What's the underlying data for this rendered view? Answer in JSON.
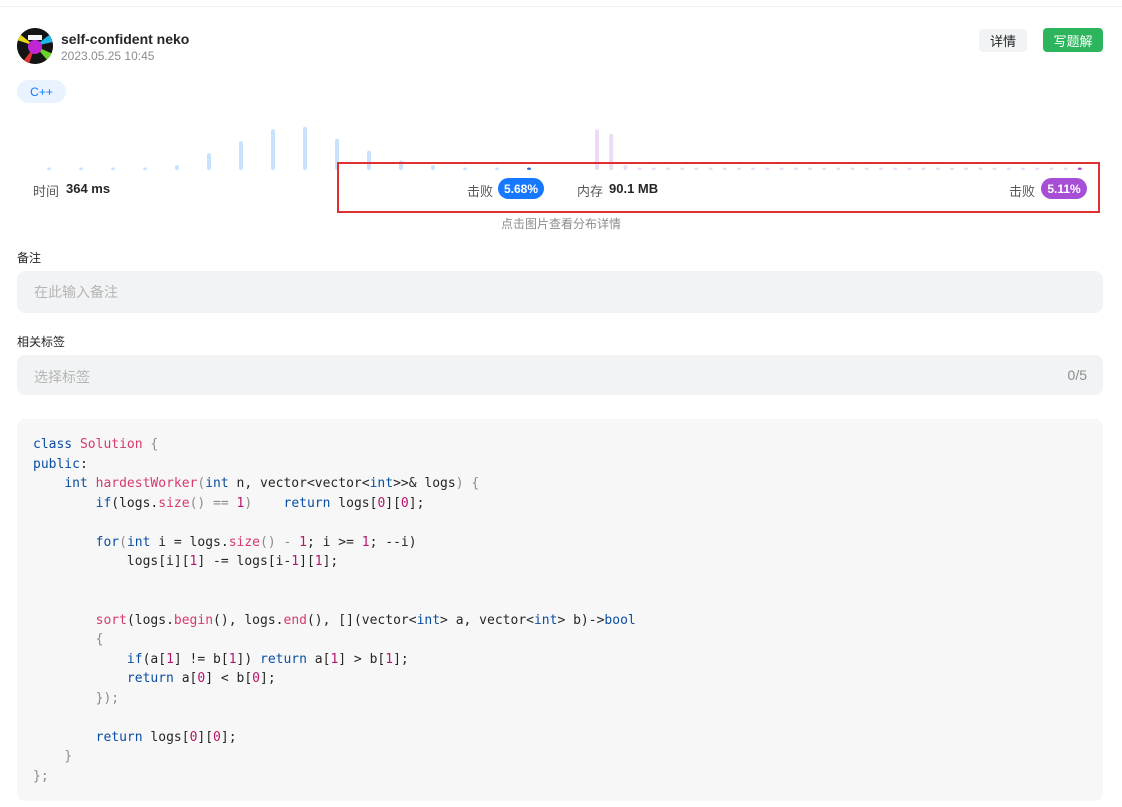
{
  "header": {
    "username": "self-confident neko",
    "timestamp": "2023.05.25 10:45",
    "detail_button": "详情",
    "write_solution_button": "写题解",
    "language_tag": "C++"
  },
  "stats": {
    "time_label": "时间",
    "time_value": "364 ms",
    "time_beat_label": "击败",
    "time_beat_value": "5.68%",
    "memory_label": "内存",
    "memory_value": "90.1 MB",
    "memory_beat_label": "击败",
    "memory_beat_value": "5.11%",
    "hint": "点击图片查看分布详情"
  },
  "chart_data": {
    "type": "bar",
    "series": [
      {
        "name": "",
        "color": "#c9e2fb",
        "highlight_color": "#2f6fcf",
        "values": [
          1,
          1,
          1,
          1,
          2,
          7,
          12,
          17,
          18,
          13,
          8,
          4,
          2,
          1,
          1,
          1
        ],
        "highlight_index": 15
      },
      {
        "name": "",
        "color": "#eddaf5",
        "highlight_color": "#b14fd6",
        "values": [
          17,
          15,
          2,
          1,
          1,
          1,
          1,
          1,
          1,
          1,
          1,
          1,
          1,
          1,
          1,
          1,
          1,
          1,
          1,
          1,
          1,
          1,
          1,
          1,
          1,
          1,
          1,
          1,
          1,
          1,
          1,
          1,
          1,
          1,
          1
        ],
        "highlight_index": 34
      }
    ]
  },
  "notes": {
    "label": "备注",
    "placeholder": "在此输入备注"
  },
  "tags": {
    "label": "相关标签",
    "placeholder": "选择标签",
    "count": "0/5"
  },
  "code": {
    "language": "C++",
    "lines": [
      [
        [
          "class",
          "#0b4ea2"
        ],
        [
          " ",
          ""
        ],
        [
          "Solution",
          "#d63a6a"
        ],
        [
          " {",
          "#8c8c8c"
        ]
      ],
      [
        [
          "public",
          "#0b4ea2"
        ],
        [
          ":",
          "#262626"
        ]
      ],
      [
        [
          "    ",
          ""
        ],
        [
          "int",
          "#0b4ea2"
        ],
        [
          " ",
          ""
        ],
        [
          "hardestWorker",
          "#d63a6a"
        ],
        [
          "(",
          "#8c8c8c"
        ],
        [
          "int",
          "#0b4ea2"
        ],
        [
          " n, vector<vector<",
          "#262626"
        ],
        [
          "int",
          "#0b4ea2"
        ],
        [
          ">>& logs",
          ""
        ],
        [
          ") {",
          "#8c8c8c"
        ]
      ],
      [
        [
          "        ",
          ""
        ],
        [
          "if",
          "#0b4ea2"
        ],
        [
          "(logs.",
          ""
        ],
        [
          "size",
          "#d63a6a"
        ],
        [
          "() == ",
          "#8c8c8c"
        ],
        [
          "1",
          "#b5156b"
        ],
        [
          ")    ",
          "#8c8c8c"
        ],
        [
          "return",
          "#0b4ea2"
        ],
        [
          " logs[",
          ""
        ],
        [
          "0",
          "#b5156b"
        ],
        [
          "][",
          ""
        ],
        [
          "0",
          "#b5156b"
        ],
        [
          "];",
          ""
        ]
      ],
      [],
      [
        [
          "        ",
          ""
        ],
        [
          "for",
          "#0b4ea2"
        ],
        [
          "(",
          "#8c8c8c"
        ],
        [
          "int",
          "#0b4ea2"
        ],
        [
          " i = logs.",
          ""
        ],
        [
          "size",
          "#d63a6a"
        ],
        [
          "() - ",
          "#8c8c8c"
        ],
        [
          "1",
          "#b5156b"
        ],
        [
          "; i >= ",
          ""
        ],
        [
          "1",
          "#b5156b"
        ],
        [
          "; --i)",
          ""
        ]
      ],
      [
        [
          "            logs[i][",
          ""
        ],
        [
          "1",
          "#b5156b"
        ],
        [
          "] -= logs[i-",
          ""
        ],
        [
          "1",
          "#b5156b"
        ],
        [
          "][",
          ""
        ],
        [
          "1",
          "#b5156b"
        ],
        [
          "];",
          ""
        ]
      ],
      [],
      [],
      [
        [
          "        ",
          ""
        ],
        [
          "sort",
          "#d63a6a"
        ],
        [
          "(logs.",
          ""
        ],
        [
          "begin",
          "#d63a6a"
        ],
        [
          "(), logs.",
          ""
        ],
        [
          "end",
          "#d63a6a"
        ],
        [
          "(), [](vector<",
          ""
        ],
        [
          "int",
          "#0b4ea2"
        ],
        [
          "> a, vector<",
          ""
        ],
        [
          "int",
          "#0b4ea2"
        ],
        [
          "> b)->",
          ""
        ],
        [
          "bool",
          "#0b4ea2"
        ]
      ],
      [
        [
          "        {",
          "#8c8c8c"
        ]
      ],
      [
        [
          "            ",
          ""
        ],
        [
          "if",
          "#0b4ea2"
        ],
        [
          "(a[",
          ""
        ],
        [
          "1",
          "#b5156b"
        ],
        [
          "] != b[",
          ""
        ],
        [
          "1",
          "#b5156b"
        ],
        [
          "]) ",
          ""
        ],
        [
          "return",
          "#0b4ea2"
        ],
        [
          " a[",
          ""
        ],
        [
          "1",
          "#b5156b"
        ],
        [
          "] > b[",
          ""
        ],
        [
          "1",
          "#b5156b"
        ],
        [
          "];",
          ""
        ]
      ],
      [
        [
          "            ",
          ""
        ],
        [
          "return",
          "#0b4ea2"
        ],
        [
          " a[",
          ""
        ],
        [
          "0",
          "#b5156b"
        ],
        [
          "] < b[",
          ""
        ],
        [
          "0",
          "#b5156b"
        ],
        [
          "];",
          ""
        ]
      ],
      [
        [
          "        });",
          "#8c8c8c"
        ]
      ],
      [],
      [
        [
          "        ",
          ""
        ],
        [
          "return",
          "#0b4ea2"
        ],
        [
          " logs[",
          ""
        ],
        [
          "0",
          "#b5156b"
        ],
        [
          "][",
          ""
        ],
        [
          "0",
          "#b5156b"
        ],
        [
          "];",
          ""
        ]
      ],
      [
        [
          "    }",
          "#8c8c8c"
        ]
      ],
      [
        [
          "};",
          "#8c8c8c"
        ]
      ]
    ]
  }
}
